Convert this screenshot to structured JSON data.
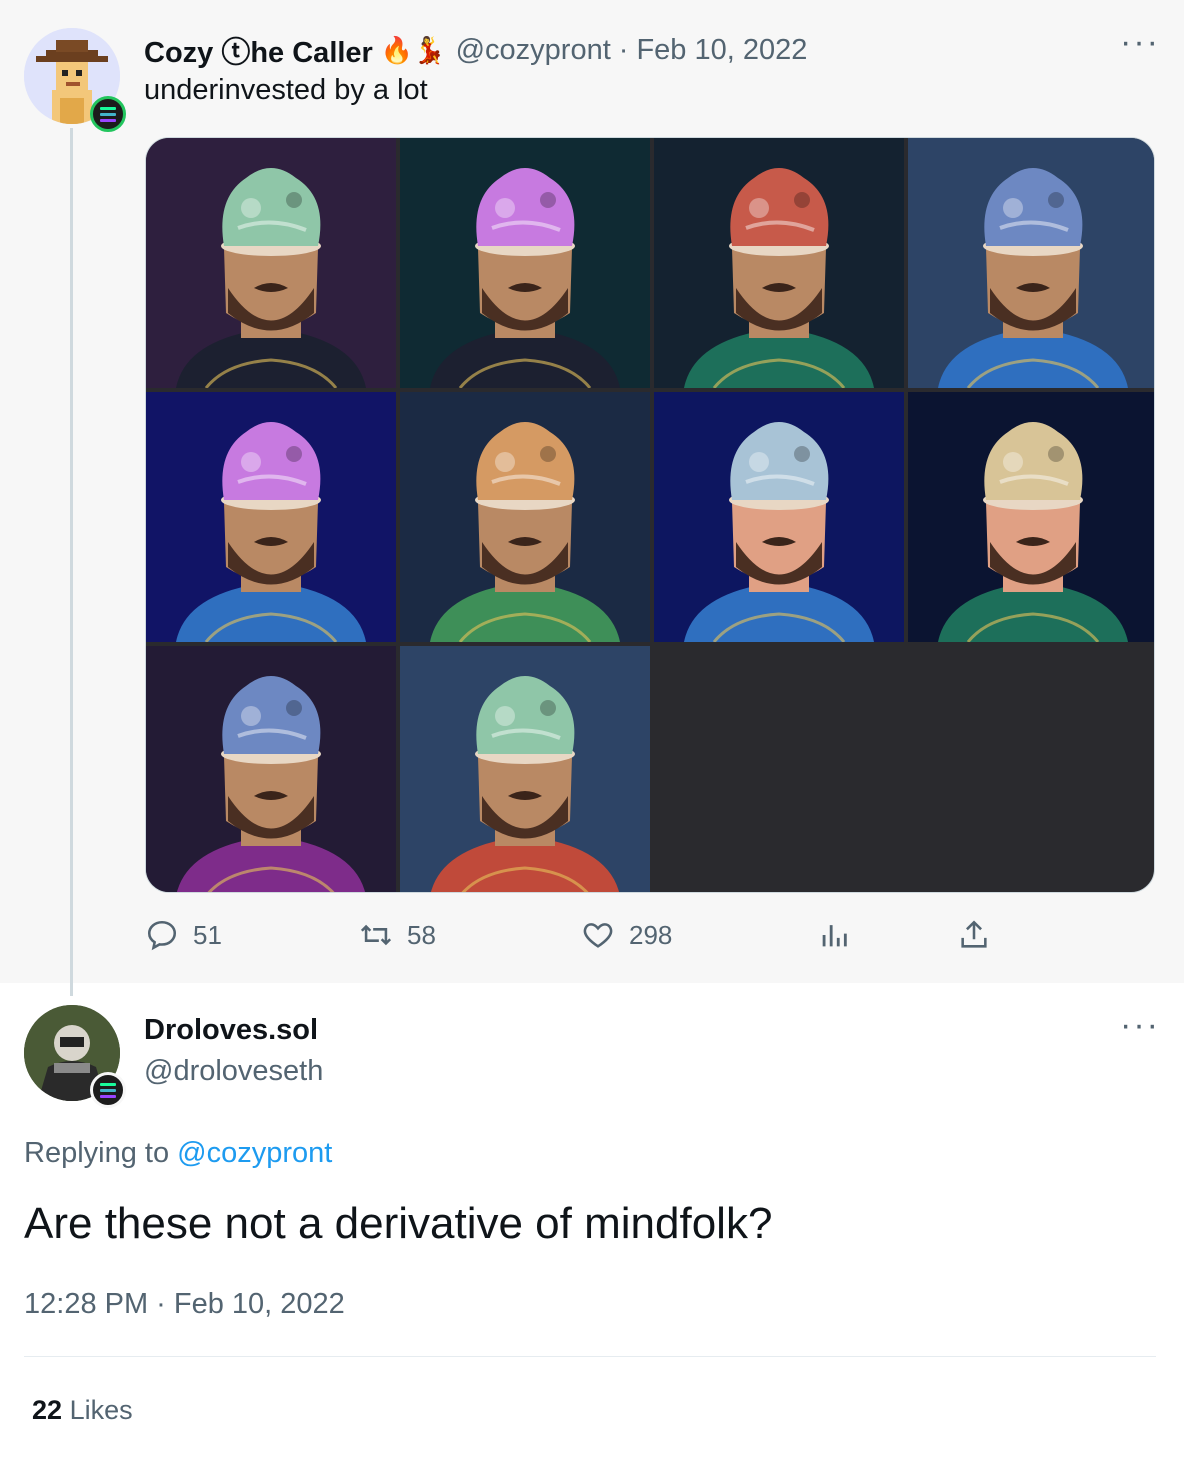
{
  "parent_tweet": {
    "author_name": "Cozy ⓣhe Caller",
    "emojis": "🔥💃",
    "handle": "@cozypront",
    "separator": "·",
    "date": "Feb 10, 2022",
    "text": "underinvested by a lot",
    "more_icon": "more-horizontal-icon",
    "media_tiles": [
      {
        "bg": "#2e1f3e",
        "crown": "#8fc6a8",
        "shirt": "#1c2030",
        "skin": "#b98964"
      },
      {
        "bg": "#0f2a33",
        "crown": "#c77ae0",
        "shirt": "#1c2030",
        "skin": "#b98964"
      },
      {
        "bg": "#142230",
        "crown": "#c75a4a",
        "shirt": "#1d6f5a",
        "skin": "#b98964"
      },
      {
        "bg": "#2d4466",
        "crown": "#6d88c2",
        "shirt": "#2f6fbf",
        "skin": "#b98964"
      },
      {
        "bg": "#111466",
        "crown": "#c77ae0",
        "shirt": "#2f6fbf",
        "skin": "#b98964"
      },
      {
        "bg": "#1b2a44",
        "crown": "#d59a63",
        "shirt": "#3e8f58",
        "skin": "#b98964"
      },
      {
        "bg": "#0d1660",
        "crown": "#a8c3d6",
        "shirt": "#2f6fbf",
        "skin": "#e0a084"
      },
      {
        "bg": "#0b1431",
        "crown": "#d8c497",
        "shirt": "#1d6f5a",
        "skin": "#e0a084"
      },
      {
        "bg": "#231b35",
        "crown": "#6d88c2",
        "shirt": "#7e2c8a",
        "skin": "#b98964"
      },
      {
        "bg": "#2d4466",
        "crown": "#8fc6a8",
        "shirt": "#c04a3a",
        "skin": "#b98964"
      }
    ],
    "stats": {
      "replies": "51",
      "retweets": "58",
      "likes": "298"
    }
  },
  "reply_tweet": {
    "author_name": "Droloves.sol",
    "handle": "@droloveseth",
    "replying_prefix": "Replying to ",
    "replying_to": "@cozypront",
    "text": "Are these not a derivative of mindfolk?",
    "timestamp": "12:28 PM · Feb 10, 2022",
    "likes_count": "22",
    "likes_label": "Likes"
  },
  "colors": {
    "link": "#1d9bf0",
    "muted": "#536471",
    "text": "#0f1419",
    "solana_badge": [
      "#9945ff",
      "#43b4ca",
      "#19fb9b"
    ]
  }
}
